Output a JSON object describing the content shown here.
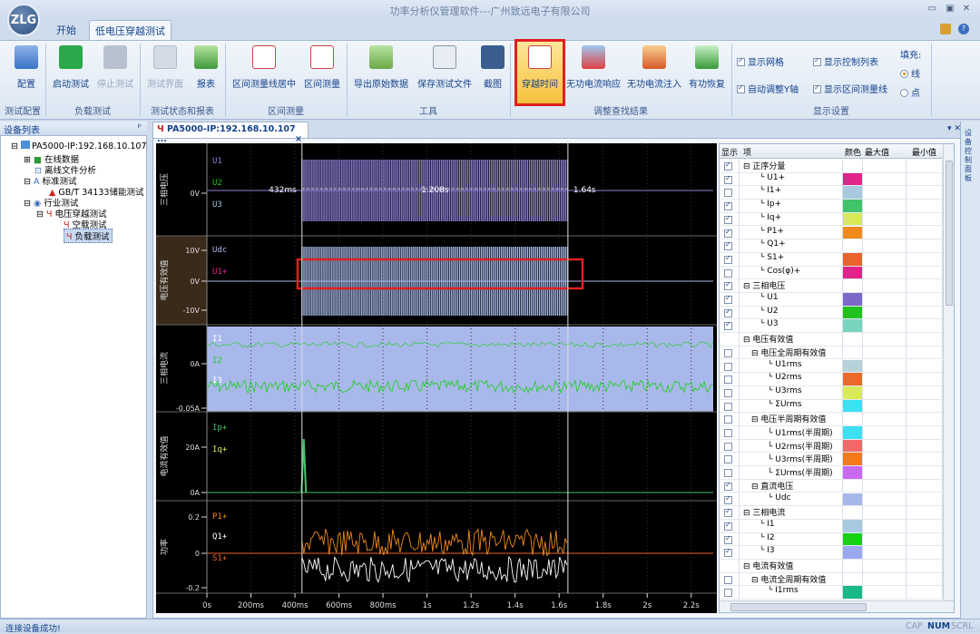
{
  "app": {
    "title": "功率分析仪管理软件---广州致远电子有限公司",
    "logo": "ZLG"
  },
  "tabs": {
    "start": "开始",
    "low_voltage": "低电压穿越测试"
  },
  "ribbon": {
    "config": "配置",
    "start_test": "启动测试",
    "stop_test": "停止测试",
    "test_ui": "测试界面",
    "report": "报表",
    "interval_center": "区间测量线居中",
    "interval_measure": "区间测量",
    "export_raw": "导出原始数据",
    "save_file": "保存测试文件",
    "screenshot": "截图",
    "through_time": "穿越时间",
    "reactive_response": "无功电流响应",
    "reactive_inject": "无功电流注入",
    "active_recover": "有功恢复",
    "show_grid": "显示网格",
    "auto_y": "自动调整Y轴",
    "show_ctrl_list": "显示控制列表",
    "show_interval_line": "显示区间测量线",
    "fill_label": "填充:",
    "fill_line": "线",
    "fill_point": "点",
    "groups": {
      "test_config": "测试配置",
      "load_test": "负载测试",
      "test_status": "测试状态和报表",
      "interval": "区间测量",
      "tools": "工具",
      "adjust": "调整查找结果",
      "display": "显示设置"
    }
  },
  "left_panel": {
    "title": "设备列表",
    "pin": "ᵖ",
    "items": [
      "PA5000-IP:192.168.10.107",
      "在线数据",
      "离线文件分析",
      "标准测试",
      "GB/T 34133储能测试",
      "行业测试",
      "电压穿越测试",
      "空载测试",
      "负载测试"
    ]
  },
  "doc_tab": {
    "label": "PA5000-IP:192.168.10.107 ...",
    "close": "×"
  },
  "plot": {
    "panels": [
      {
        "ylabel": "三相电压",
        "ticks": [
          "0V"
        ],
        "series": [
          "U1",
          "U2",
          "U3"
        ]
      },
      {
        "ylabel": "电压有效值",
        "ticks": [
          "10V",
          "0V",
          "-10V"
        ],
        "series": [
          "Udc",
          "U1+"
        ]
      },
      {
        "ylabel": "三相电流",
        "ticks": [
          "0A",
          "-0.05A"
        ],
        "series": [
          "I1",
          "I2",
          "I3"
        ]
      },
      {
        "ylabel": "电流有效值",
        "ticks": [
          "20A",
          "0A"
        ],
        "series": [
          "Ip+",
          "Iq+"
        ]
      },
      {
        "ylabel": "功率",
        "ticks": [
          "0.2",
          "0",
          "-0.2"
        ],
        "series": [
          "P1+",
          "Q1+",
          "S1+"
        ]
      }
    ],
    "markers": {
      "t1": "432ms",
      "dt": "1.208s",
      "t2": "1.64s"
    },
    "xticks": [
      "0s",
      "200ms",
      "400ms",
      "600ms",
      "800ms",
      "1s",
      "1.2s",
      "1.4s",
      "1.6s",
      "1.8s",
      "2s",
      "2.2s"
    ]
  },
  "table": {
    "headers": {
      "show": "显示",
      "item": "项",
      "color": "颜色",
      "max": "最大值",
      "min": "最小值"
    },
    "rows": [
      {
        "chk": true,
        "indent": 0,
        "exp": "⊟",
        "name": "正序分量",
        "color": ""
      },
      {
        "chk": true,
        "indent": 2,
        "exp": "",
        "name": "U1+",
        "color": "#e0248c"
      },
      {
        "chk": false,
        "indent": 2,
        "exp": "",
        "name": "I1+",
        "color": "#a9c9e0"
      },
      {
        "chk": true,
        "indent": 2,
        "exp": "",
        "name": "Ip+",
        "color": "#3fc46a"
      },
      {
        "chk": true,
        "indent": 2,
        "exp": "",
        "name": "Iq+",
        "color": "#d8e85a"
      },
      {
        "chk": true,
        "indent": 2,
        "exp": "",
        "name": "P1+",
        "color": "#f08a1c"
      },
      {
        "chk": true,
        "indent": 2,
        "exp": "",
        "name": "Q1+",
        "color": "#ffffff"
      },
      {
        "chk": true,
        "indent": 2,
        "exp": "",
        "name": "S1+",
        "color": "#e8642c"
      },
      {
        "chk": false,
        "indent": 2,
        "exp": "",
        "name": "Cos(φ)+",
        "color": "#e0248c"
      },
      {
        "chk": true,
        "indent": 0,
        "exp": "⊟",
        "name": "三相电压",
        "color": ""
      },
      {
        "chk": true,
        "indent": 2,
        "exp": "",
        "name": "U1",
        "color": "#7b68c8"
      },
      {
        "chk": true,
        "indent": 2,
        "exp": "",
        "name": "U2",
        "color": "#22c21c"
      },
      {
        "chk": true,
        "indent": 2,
        "exp": "",
        "name": "U3",
        "color": "#79d4bf"
      },
      {
        "chk": null,
        "indent": 0,
        "exp": "⊟",
        "name": "电压有效值",
        "color": ""
      },
      {
        "chk": false,
        "indent": 1,
        "exp": "⊟",
        "name": "电压全周期有效值",
        "color": ""
      },
      {
        "chk": false,
        "indent": 3,
        "exp": "",
        "name": "U1rms",
        "color": "#b6d2d8"
      },
      {
        "chk": false,
        "indent": 3,
        "exp": "",
        "name": "U2rms",
        "color": "#ea6a2c"
      },
      {
        "chk": false,
        "indent": 3,
        "exp": "",
        "name": "U3rms",
        "color": "#d9ea5a"
      },
      {
        "chk": false,
        "indent": 3,
        "exp": "",
        "name": "ΣUrms",
        "color": "#3de0f0"
      },
      {
        "chk": false,
        "indent": 1,
        "exp": "⊟",
        "name": "电压半周期有效值",
        "color": ""
      },
      {
        "chk": false,
        "indent": 3,
        "exp": "",
        "name": "U1rms(半周期)",
        "color": "#3de0f0"
      },
      {
        "chk": false,
        "indent": 3,
        "exp": "",
        "name": "U2rms(半周期)",
        "color": "#f06a6a"
      },
      {
        "chk": false,
        "indent": 3,
        "exp": "",
        "name": "U3rms(半周期)",
        "color": "#f07a1c"
      },
      {
        "chk": false,
        "indent": 3,
        "exp": "",
        "name": "ΣUrms(半周期)",
        "color": "#c86af0"
      },
      {
        "chk": true,
        "indent": 1,
        "exp": "⊟",
        "name": "直流电压",
        "color": ""
      },
      {
        "chk": true,
        "indent": 3,
        "exp": "",
        "name": "Udc",
        "color": "#a6b8e8"
      },
      {
        "chk": true,
        "indent": 0,
        "exp": "⊟",
        "name": "三相电流",
        "color": ""
      },
      {
        "chk": true,
        "indent": 2,
        "exp": "",
        "name": "I1",
        "color": "#a9c9e0"
      },
      {
        "chk": true,
        "indent": 2,
        "exp": "",
        "name": "I2",
        "color": "#18d018"
      },
      {
        "chk": true,
        "indent": 2,
        "exp": "",
        "name": "I3",
        "color": "#9aa8f0"
      },
      {
        "chk": null,
        "indent": 0,
        "exp": "⊟",
        "name": "电流有效值",
        "color": ""
      },
      {
        "chk": false,
        "indent": 1,
        "exp": "⊟",
        "name": "电流全周期有效值",
        "color": ""
      },
      {
        "chk": false,
        "indent": 3,
        "exp": "",
        "name": "I1rms",
        "color": "#18b888"
      }
    ]
  },
  "right_strip": "设备控制面板",
  "status": {
    "left": "连接设备成功!",
    "caps": "CAP",
    "num": "NUM",
    "scrl": "SCRL"
  }
}
